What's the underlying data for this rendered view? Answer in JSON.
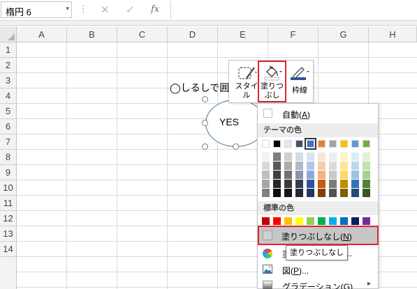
{
  "formula_bar": {
    "name_box_value": "楕円 6",
    "name_box_arrow": "▾",
    "separator": "⋮",
    "cancel_symbol": "✕",
    "enter_symbol": "✓",
    "function_symbol": "fx",
    "formula_value": ""
  },
  "grid": {
    "columns": [
      "A",
      "B",
      "C",
      "D",
      "E",
      "F",
      "G",
      "H"
    ],
    "rows": [
      "1",
      "2",
      "3",
      "4",
      "5",
      "6",
      "7",
      "8",
      "9",
      "10",
      "11",
      "12",
      "13",
      "14"
    ]
  },
  "sheet": {
    "cell_text": "◯しるしで囲",
    "shape_text": "YES"
  },
  "mini_toolbar": {
    "style_label_1": "スタイ",
    "style_label_2": "ル",
    "fill_label_1": "塗りつ",
    "fill_label_2": "ぶし",
    "outline_label": "枠線"
  },
  "fill_menu": {
    "automatic_label": "自動",
    "automatic_key": "A",
    "theme_colors_header": "テーマの色",
    "standard_colors_header": "標準の色",
    "no_fill_label": "塗りつぶしなし",
    "no_fill_key": "N",
    "more_colors_suffix": "...",
    "picture_label": "図",
    "picture_key": "P",
    "picture_suffix": "...",
    "gradient_label": "グラデーション",
    "gradient_key": "G",
    "submenu_arrow": "▸",
    "tooltip": "塗りつぶしなし",
    "theme_top_row": [
      "#ffffff",
      "#000000",
      "#e7e6e6",
      "#44546a",
      "#4472c4",
      "#ed7d31",
      "#a5a5a5",
      "#ffc000",
      "#5b9bd5",
      "#70ad47"
    ],
    "theme_shades": [
      [
        "#f2f2f2",
        "#d9d9d9",
        "#bfbfbf",
        "#a6a6a6",
        "#808080"
      ],
      [
        "#7f7f7f",
        "#595959",
        "#404040",
        "#262626",
        "#0d0d0d"
      ],
      [
        "#d0cece",
        "#aeaaaa",
        "#757171",
        "#3a3838",
        "#171616"
      ],
      [
        "#d6dce4",
        "#adb9ca",
        "#8497b0",
        "#333f4f",
        "#222a35"
      ],
      [
        "#d9e2f3",
        "#b4c6e7",
        "#8eaadb",
        "#2f5496",
        "#1f3864"
      ],
      [
        "#fbe5d5",
        "#f7caac",
        "#f4b183",
        "#c55a11",
        "#843c0b"
      ],
      [
        "#ededed",
        "#dbdbdb",
        "#c9c9c9",
        "#7b7b7b",
        "#525252"
      ],
      [
        "#fff2cc",
        "#ffe599",
        "#ffd966",
        "#bf8f00",
        "#7f6000"
      ],
      [
        "#deebf6",
        "#bdd7ee",
        "#9dc3e6",
        "#2e75b5",
        "#1f4e79"
      ],
      [
        "#e2efd9",
        "#c5e0b3",
        "#a8d08d",
        "#538135",
        "#375623"
      ]
    ],
    "standard_colors": [
      "#c00000",
      "#ff0000",
      "#ffc000",
      "#ffff00",
      "#92d050",
      "#00b050",
      "#00b0f0",
      "#0070c0",
      "#002060",
      "#7030a0"
    ]
  },
  "colors": {
    "highlight_red": "#e0242c",
    "shape_outline": "#41719c",
    "selected_swatch": "#4472c4"
  }
}
